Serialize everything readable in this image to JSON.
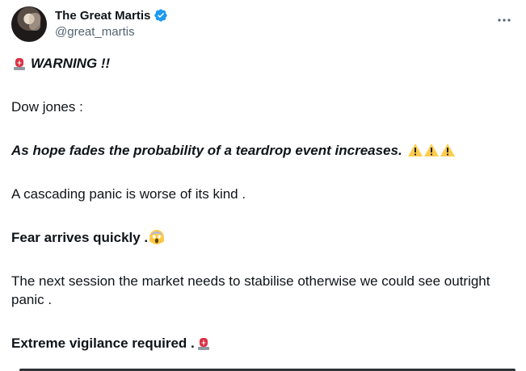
{
  "user": {
    "display_name": "The Great Martis",
    "handle": "@great_martis",
    "verified": true,
    "verified_color": "#1d9bf0"
  },
  "tweet": {
    "warning_label": "WARNING !!",
    "dow_label": "Dow jones :",
    "teardrop_line": "As hope fades the probability of a teardrop event increases.",
    "cascading_line": "A cascading panic is worse of its kind .",
    "fear_line": "Fear arrives quickly .",
    "session_line": "The next session the  market needs to  stabilise otherwise we could see outright panic .",
    "vigilance_line": "Extreme vigilance required ."
  },
  "icons": {
    "siren": "siren-icon",
    "warning": "warning-icon",
    "scream": "screaming-face-icon",
    "verified": "verified-badge-icon",
    "more": "more-options-icon"
  }
}
